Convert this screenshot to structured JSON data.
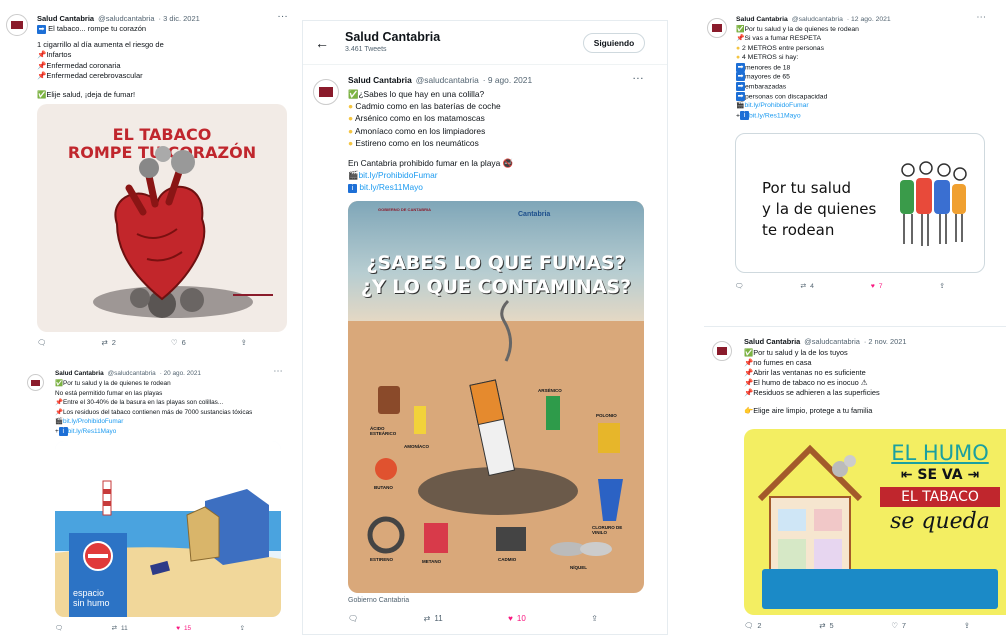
{
  "t1": {
    "name": "Salud Cantabria",
    "handle": "@saludcantabria",
    "date": "· 3 dic. 2021",
    "lines": [
      "El tabaco... rompe tu corazón",
      "1 cigarrillo al día aumenta el riesgo de",
      "Infartos",
      "Enfermedad coronaria",
      "Enfermedad cerebrovascular",
      "",
      "Elije salud, ¡deja de fumar!"
    ],
    "image_text": {
      "line1": "EL TABACO",
      "line2": "ROMPE TU CORAZÓN"
    },
    "retweets": "2",
    "likes": "6"
  },
  "t2": {
    "name": "Salud Cantabria",
    "handle": "@saludcantabria",
    "date": "· 20 ago. 2021",
    "lines": [
      "Por tu salud y la de quienes te rodean",
      "No está permitido fumar en las playas",
      "Entre el 30-40% de la basura en las playas son colillas...",
      "Los residuos del tabaco contienen más de 7000 sustancias tóxicas",
      "bit.ly/ProhibidoFumar",
      "bit.ly/Res11Mayo"
    ],
    "sign": {
      "l1": "espacio",
      "l2": "sin humo"
    },
    "retweets": "11",
    "likes": "15"
  },
  "t3": {
    "back_label": "←",
    "title": "Salud Cantabria",
    "subtitle": "3.461 Tweets",
    "follow_label": "Siguiendo",
    "name": "Salud Cantabria",
    "handle": "@saludcantabria",
    "date": "· 9 ago. 2021",
    "lines": [
      "¿Sabes lo que hay en una colilla?",
      "Cadmio como en las baterías de coche",
      "Arsénico como en los matamoscas",
      "Amoníaco como en los limpiadores",
      "Estireno como en los neumáticos",
      "",
      "En Cantabria prohibido fumar en la playa",
      "bit.ly/ProhibidoFumar",
      "bit.ly/Res11Mayo"
    ],
    "poster": {
      "gov": "GOBIERNO DE CANTABRIA",
      "brand": "Cantabria",
      "line1": "¿SABES LO QUE FUMAS?",
      "line2": "¿Y LO QUE CONTAMINAS?",
      "labels": [
        "ARSÉNICO",
        "ÁCIDO ESTEÁRICO",
        "AMONÍACO",
        "POLONIO",
        "BUTANO",
        "CLORURO DE VINILO",
        "ESTIRENO",
        "METANO",
        "CADMIO",
        "NÍQUEL"
      ]
    },
    "caption": "Gobierno Cantabria",
    "retweets": "11",
    "likes": "10"
  },
  "t4": {
    "name": "Salud Cantabria",
    "handle": "@saludcantabria",
    "date": "· 12 ago. 2021",
    "lines": [
      "Por tu salud y la de quienes te rodean",
      "Si vas a fumar RESPETA",
      "2 METROS entre personas",
      "4 METROS si hay:",
      "menores de 18",
      "mayores de 65",
      "embarazadas",
      "personas con discapacidad",
      "bit.ly/ProhibidoFumar",
      "bit.ly/Res11Mayo"
    ],
    "card_l1": "Por tu salud",
    "card_l2": "y la de quienes",
    "card_l3": "te rodean",
    "retweets": "4",
    "likes": "7"
  },
  "t5": {
    "name": "Salud Cantabria",
    "handle": "@saludcantabria",
    "date": "· 2 nov. 2021",
    "lines": [
      "Por tu salud y la de los tuyos",
      "no fumes en casa",
      "Abrir las ventanas no es suficiente",
      "El humo de tabaco no es inocuo",
      "Residuos se adhieren a las superficies",
      "",
      "Elige aire limpio, protege a tu familia"
    ],
    "poster": {
      "l1": "EL HUMO",
      "l2": "SE VA",
      "l3": "EL TABACO",
      "l4": "se queda"
    },
    "replies": "2",
    "retweets": "5",
    "likes": "7"
  },
  "colors": {
    "link": "#1d9bf0",
    "like": "#f91880",
    "muted": "#536471",
    "heart_red": "#c0262d"
  }
}
